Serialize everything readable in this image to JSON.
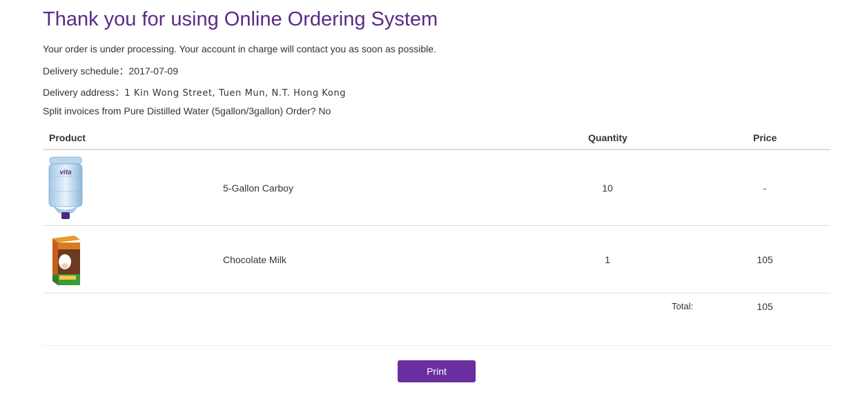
{
  "header": {
    "title": "Thank you for using Online Ordering System"
  },
  "info": {
    "processing_message": "Your order is under processing. Your account in charge will contact you as soon as possible.",
    "delivery_schedule_label": "Delivery schedule：",
    "delivery_schedule_value": "2017-07-09",
    "delivery_address_label": "Delivery address：",
    "delivery_address_value": "1 Kin Wong Street, Tuen Mun, N.T. Hong Kong",
    "split_invoice_text": "Split invoices from Pure Distilled Water (5gallon/3gallon) Order? No"
  },
  "table": {
    "headers": {
      "product": "Product",
      "quantity": "Quantity",
      "price": "Price"
    },
    "rows": [
      {
        "name": "5-Gallon Carboy",
        "quantity": "10",
        "price": "-",
        "image_icon": "water-bottle-icon",
        "brand": "vita"
      },
      {
        "name": "Chocolate Milk",
        "quantity": "1",
        "price": "105",
        "image_icon": "milk-carton-icon"
      }
    ],
    "total_label": "Total:",
    "total_value": "105"
  },
  "actions": {
    "print_label": "Print"
  },
  "colors": {
    "title": "#5b2a86",
    "button": "#6a2ea0"
  }
}
